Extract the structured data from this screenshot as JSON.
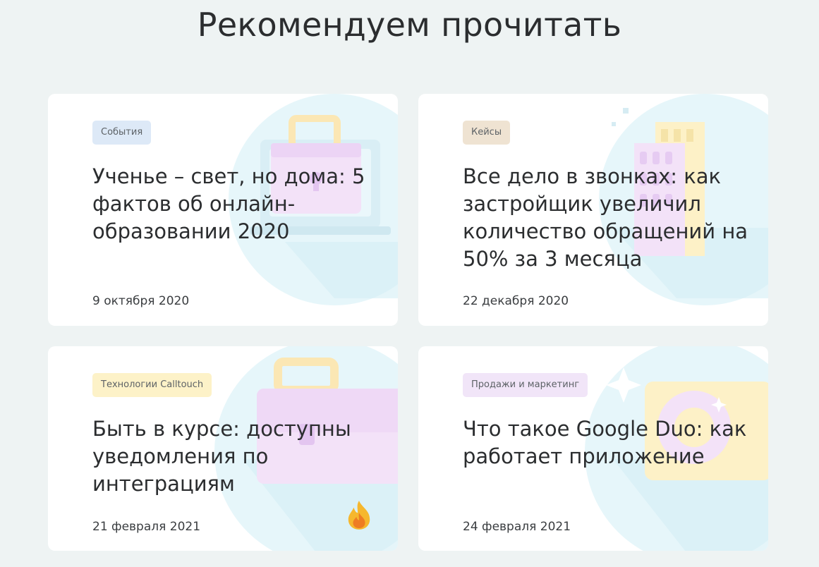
{
  "section": {
    "title": "Рекомендуем прочитать"
  },
  "cards": [
    {
      "tag": "События",
      "title": "Ученье – свет, но дома: 5 фактов об онлайн-образовании 2020",
      "date": "9 октября 2020"
    },
    {
      "tag": "Кейсы",
      "title": "Все дело в звонках: как застройщик увеличил количество обращений на 50% за 3 месяца",
      "date": "22 декабря 2020"
    },
    {
      "tag": "Технологии Calltouch",
      "title": "Быть в курсе: доступны уведомления по интеграциям",
      "date": "21 февраля 2021"
    },
    {
      "tag": "Продажи и маркетинг",
      "title": "Что такое Google Duo: как работает приложение",
      "date": "24 февраля 2021"
    }
  ],
  "colors": {
    "background": "#eef3f3",
    "card": "#ffffff",
    "illustration_circle": "#e3f4f8",
    "tag_events": "#dde9f7",
    "tag_cases": "#efe3d2",
    "tag_tech": "#fdf2c8",
    "tag_sales": "#f1e5f8"
  },
  "icons": {
    "card1": "briefcase-monitor-illustration",
    "card2": "buildings-illustration",
    "card3": "briefcase-illustration",
    "card4": "phone-app-illustration",
    "hot": "fire-icon"
  }
}
